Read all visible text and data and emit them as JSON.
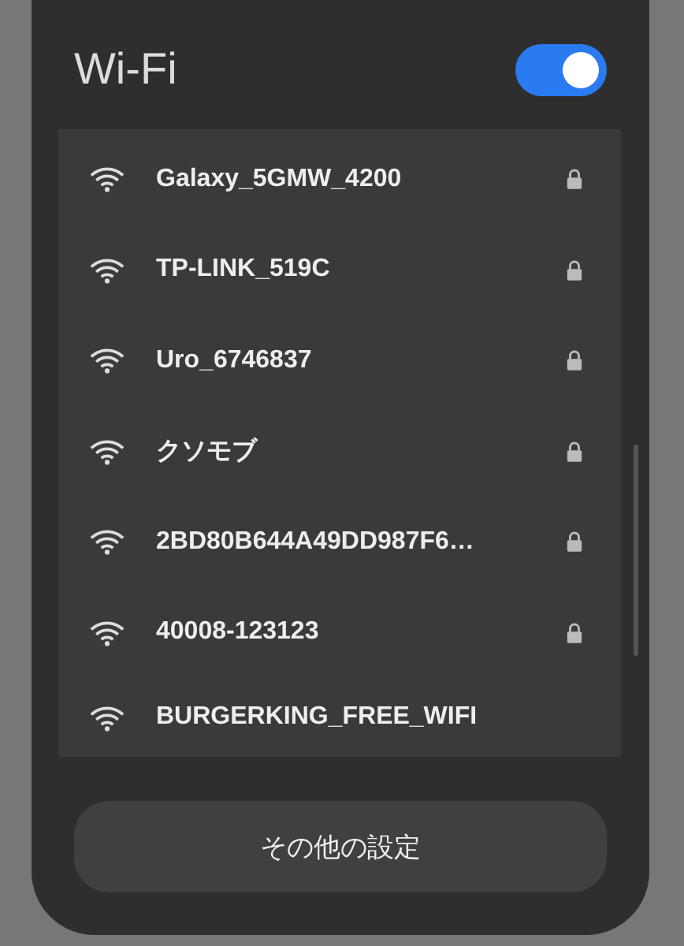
{
  "title": "Wi-Fi",
  "toggle": {
    "on": true
  },
  "networks": [
    {
      "name": "Galaxy_5GMW_4200",
      "locked": true
    },
    {
      "name": "TP-LINK_519C",
      "locked": true
    },
    {
      "name": "Uro_6746837",
      "locked": true
    },
    {
      "name": "クソモブ",
      "locked": true
    },
    {
      "name": "2BD80B644A49DD987F6…",
      "locked": true
    },
    {
      "name": "40008-123123",
      "locked": true
    },
    {
      "name": "BURGERKING_FREE_WIFI",
      "locked": false
    }
  ],
  "button": "その他の設定"
}
